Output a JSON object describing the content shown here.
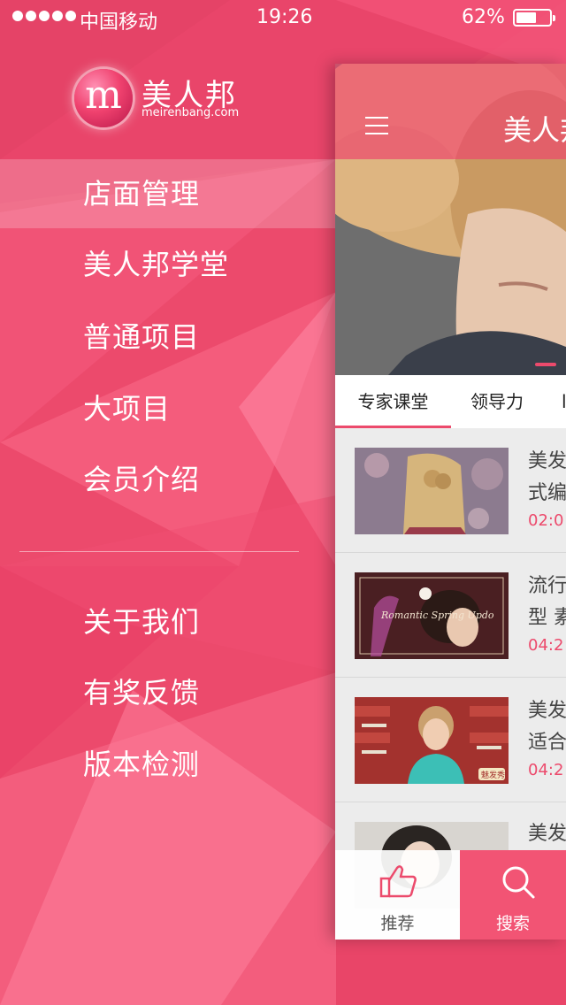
{
  "status_bar": {
    "carrier": "中国移动",
    "time": "19:26",
    "battery_pct": "62%",
    "battery_level": 0.62
  },
  "app": {
    "name": "美人邦",
    "domain": "meirenbang.com",
    "logo_letter": "m"
  },
  "menu": {
    "items": [
      {
        "label": "店面管理",
        "active": true
      },
      {
        "label": "美人邦学堂"
      },
      {
        "label": "普通项目"
      },
      {
        "label": "大项目"
      },
      {
        "label": "会员介绍"
      }
    ],
    "secondary": [
      {
        "label": "关于我们"
      },
      {
        "label": "有奖反馈"
      },
      {
        "label": "版本检测"
      }
    ]
  },
  "panel": {
    "title": "美人邦",
    "tabs": [
      {
        "label": "专家课堂"
      },
      {
        "label": "领导力"
      },
      {
        "label": "l"
      }
    ],
    "videos": [
      {
        "title_line1": "美发",
        "title_line2": "式编",
        "time": "02:0"
      },
      {
        "title_line1": "流行",
        "title_line2": "型 素",
        "time": "04:2",
        "thumb_caption": "Romantic Spring Updo"
      },
      {
        "title_line1": "美发",
        "title_line2": "适合",
        "time": "04:2",
        "thumb_caption": "魅发秀"
      },
      {
        "title_line1": "美发"
      }
    ],
    "bottom": {
      "recommend": "推荐",
      "search": "搜索"
    }
  },
  "colors": {
    "accent": "#ec4a6c",
    "bg_pink": "#ec4a6c"
  }
}
